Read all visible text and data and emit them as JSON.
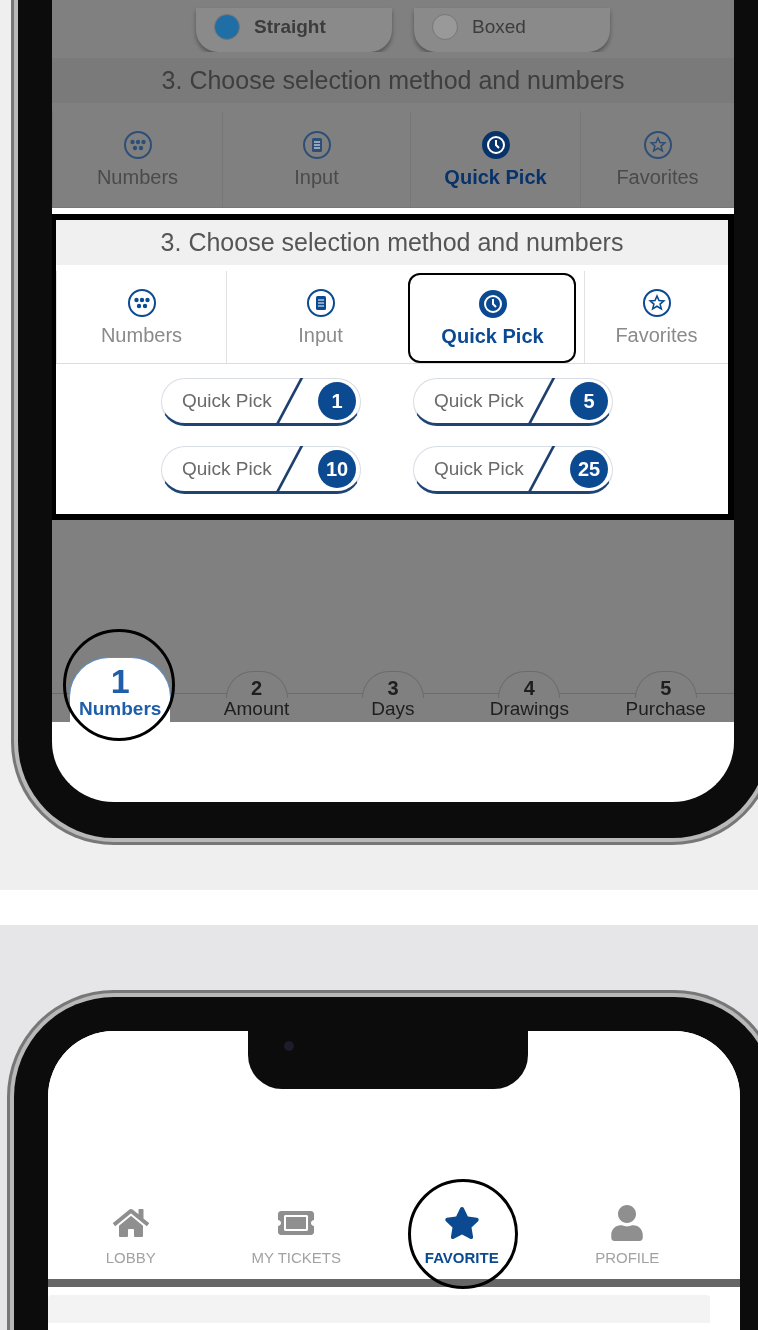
{
  "top_phone": {
    "radios": [
      {
        "label": "Straight",
        "selected": true
      },
      {
        "label": "Boxed",
        "selected": false
      }
    ],
    "dimmed_section": {
      "title": "3. Choose selection method and numbers",
      "tabs": [
        {
          "label": "Numbers",
          "selected": false
        },
        {
          "label": "Input",
          "selected": false
        },
        {
          "label": "Quick Pick",
          "selected": true
        },
        {
          "label": "Favorites",
          "selected": false
        }
      ]
    },
    "highlighted_section": {
      "title": "3. Choose selection method and numbers",
      "tabs": [
        {
          "label": "Numbers",
          "selected": false
        },
        {
          "label": "Input",
          "selected": false
        },
        {
          "label": "Quick Pick",
          "selected": true
        },
        {
          "label": "Favorites",
          "selected": false
        }
      ],
      "quick_picks": [
        {
          "label": "Quick Pick",
          "count": "1"
        },
        {
          "label": "Quick Pick",
          "count": "5"
        },
        {
          "label": "Quick Pick",
          "count": "10"
        },
        {
          "label": "Quick Pick",
          "count": "25"
        }
      ]
    },
    "steps": [
      {
        "number": "1",
        "label": "Numbers",
        "selected": true
      },
      {
        "number": "2",
        "label": "Amount",
        "selected": false
      },
      {
        "number": "3",
        "label": "Days",
        "selected": false
      },
      {
        "number": "4",
        "label": "Drawings",
        "selected": false
      },
      {
        "number": "5",
        "label": "Purchase",
        "selected": false
      }
    ]
  },
  "bottom_phone": {
    "nav": [
      {
        "label": "LOBBY",
        "selected": false
      },
      {
        "label": "MY TICKETS",
        "selected": false
      },
      {
        "label": "FAVORITE",
        "selected": true
      },
      {
        "label": "PROFILE",
        "selected": false
      }
    ]
  }
}
